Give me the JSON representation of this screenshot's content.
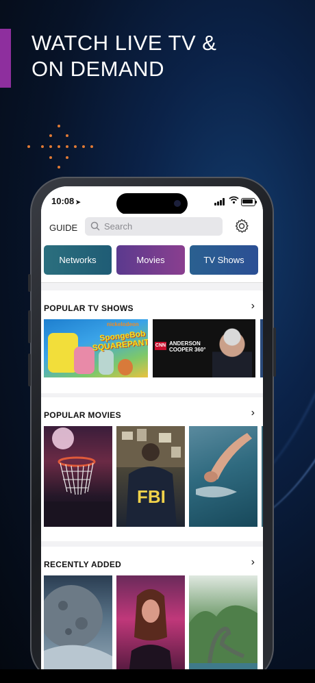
{
  "promo": {
    "headline": "WATCH LIVE TV &\nON DEMAND",
    "accent_color": "#8e2f9e",
    "dots_color": "#e07a35"
  },
  "status_bar": {
    "time": "10:08",
    "location_icon": "location-arrow-icon",
    "signal_icon": "cellular-signal-icon",
    "wifi_icon": "wifi-icon",
    "battery_icon": "battery-icon"
  },
  "header": {
    "guide_label": "GUIDE",
    "search_placeholder": "Search",
    "settings_icon": "gear-icon"
  },
  "chips": [
    {
      "label": "Networks"
    },
    {
      "label": "Movies"
    },
    {
      "label": "TV Shows"
    }
  ],
  "sections": [
    {
      "title": "POPULAR TV SHOWS",
      "items": [
        {
          "image": "SpongeBob SquarePants poster",
          "brand": "nickelodeon",
          "logo_text": "SpongeBob SQUAREPANTS"
        },
        {
          "image": "Anderson Cooper 360 poster",
          "network": "CNN",
          "logo_text": "ANDERSON COOPER 360°"
        }
      ]
    },
    {
      "title": "POPULAR MOVIES",
      "items": [
        {
          "image": "basketball hoop poster"
        },
        {
          "image": "FBI agent poster",
          "logo_text": "FBI"
        },
        {
          "image": "diver poster"
        }
      ]
    },
    {
      "title": "RECENTLY ADDED",
      "items": [
        {
          "image": "moon landscape poster"
        },
        {
          "image": "woman in pink light poster"
        },
        {
          "image": "dinosaur jungle poster"
        }
      ]
    }
  ]
}
